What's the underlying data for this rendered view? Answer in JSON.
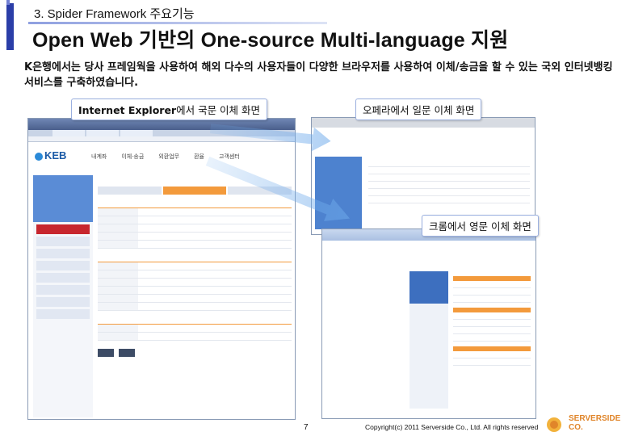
{
  "section": {
    "title": "3. Spider Framework 주요기능"
  },
  "page": {
    "title": "Open Web 기반의 One-source Multi-language 지원"
  },
  "description": {
    "text": "K은행에서는 당사 프레임웍을 사용하여 해외 다수의 사용자들이 다양한 브라우저를 사용하여 이체/송금을 할 수 있는 국외 인터넷뱅킹 서비스를 구축하였습니다."
  },
  "labels": {
    "ie_prefix": "Internet Explorer",
    "ie_suffix": "에서 국문 이체 화면",
    "opera": "오페라에서 일문 이체 화면",
    "chrome": "크롬에서 영문 이체 화면"
  },
  "ie_screen": {
    "logo": "KEB",
    "nav": [
      "내계좌",
      "이체·송금",
      "외환업무",
      "환율",
      "고객센터"
    ]
  },
  "footer": {
    "page_number": "7",
    "copyright": "Copyright(c) 2011 Serverside Co., Ltd. All rights reserved",
    "logo_text": "SERVERSIDE CO."
  },
  "colors": {
    "accent": "#2b3ea8",
    "keb_blue": "#1b5aa6",
    "step_orange": "#f39a3c",
    "logo_orange": "#e0852a"
  }
}
